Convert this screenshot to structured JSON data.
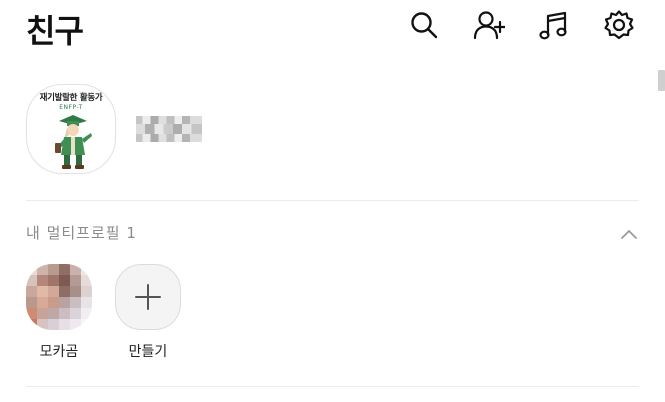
{
  "header": {
    "title": "친구",
    "icons": [
      "search-icon",
      "add-friend-icon",
      "music-icon",
      "settings-icon"
    ]
  },
  "my_profile": {
    "avatar_caption": "재기발랄한 활동가",
    "avatar_mbti": "ENFP-T"
  },
  "multi_profile": {
    "header": "내 멀티프로필 1",
    "items": [
      {
        "label": "모카곰"
      },
      {
        "label": "만들기"
      }
    ]
  },
  "colors": {
    "text_primary": "#111111",
    "text_secondary": "#8b8b8b",
    "divider": "#ececec",
    "figure_green": "#3f8f55"
  }
}
